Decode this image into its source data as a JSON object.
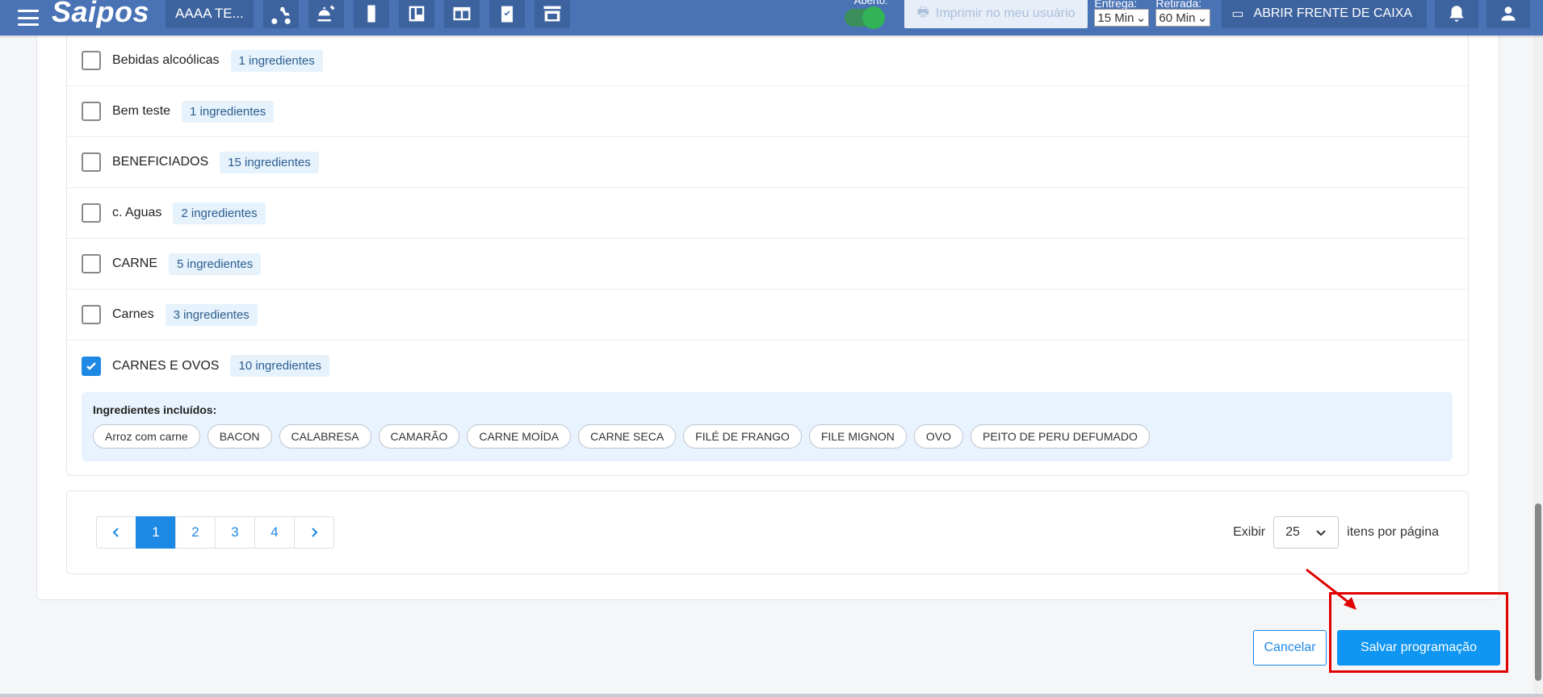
{
  "topbar": {
    "logo": "Saipos",
    "store": "AAAA TE...",
    "aberto_label": "Aberto:",
    "imprimir": "Imprimir no meu usuário",
    "entrega_label": "Entrega:",
    "entrega_value": "15 Min",
    "retirada_label": "Retirada:",
    "retirada_value": "60 Min",
    "caixa": "ABRIR FRENTE DE CAIXA"
  },
  "rows": [
    {
      "name": "Bebidas alcoólicas",
      "badge": "1 ingredientes",
      "checked": false
    },
    {
      "name": "Bem teste",
      "badge": "1 ingredientes",
      "checked": false
    },
    {
      "name": "BENEFICIADOS",
      "badge": "15 ingredientes",
      "checked": false
    },
    {
      "name": "c. Aguas",
      "badge": "2 ingredientes",
      "checked": false
    },
    {
      "name": "CARNE",
      "badge": "5 ingredientes",
      "checked": false
    },
    {
      "name": "Carnes",
      "badge": "3 ingredientes",
      "checked": false
    },
    {
      "name": "CARNES E OVOS",
      "badge": "10 ingredientes",
      "checked": true
    }
  ],
  "included": {
    "title": "Ingredientes incluídos:",
    "chips": [
      "Arroz com carne",
      "BACON",
      "CALABRESA",
      "CAMARÃO",
      "CARNE MOÍDA",
      "CARNE SECA",
      "FILÉ DE FRANGO",
      "FILE MIGNON",
      "OVO",
      "PEITO DE PERU DEFUMADO"
    ]
  },
  "pagination": {
    "pages": [
      "1",
      "2",
      "3",
      "4"
    ],
    "active": "1",
    "exibir": "Exibir",
    "per_page": "25",
    "per_page_suffix": "itens por página"
  },
  "actions": {
    "cancel": "Cancelar",
    "save": "Salvar programação"
  }
}
